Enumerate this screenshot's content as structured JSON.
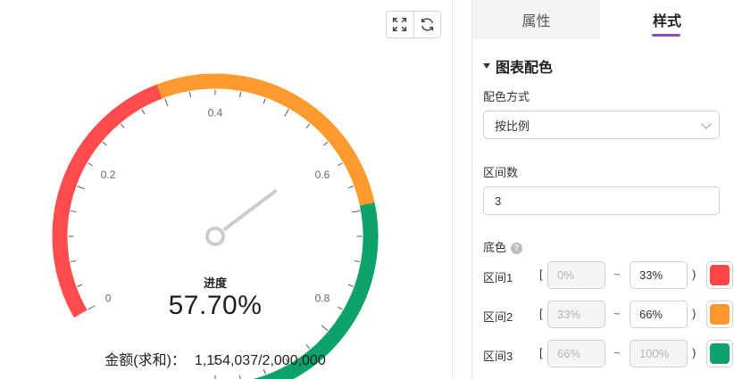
{
  "toolbar": {
    "fullscreen_icon": "fullscreen-icon",
    "refresh_icon": "refresh-icon"
  },
  "gauge": {
    "metric_name": "进度",
    "value_text": "57.70%",
    "value": 0.577,
    "min": 0,
    "max": 1,
    "ticks": [
      "0",
      "0.2",
      "0.4",
      "0.6",
      "0.8",
      "1"
    ],
    "bands": [
      {
        "from": 0,
        "to": 0.33,
        "color": "#ff4d4f"
      },
      {
        "from": 0.33,
        "to": 0.66,
        "color": "#ff9a2e"
      },
      {
        "from": 0.66,
        "to": 1,
        "color": "#0ea26b"
      }
    ],
    "pointer_color": "#cccccc",
    "amount_label": "金额(求和)：",
    "amount_value": "1,154,037/2,000,000"
  },
  "panel": {
    "tabs": [
      "属性",
      "样式"
    ],
    "active_tab": "样式",
    "section_title": "图表配色",
    "color_mode_label": "配色方式",
    "color_mode_value": "按比例",
    "interval_count_label": "区间数",
    "interval_count_value": "3",
    "base_color_label": "底色",
    "help_icon": "?",
    "ranges": [
      {
        "label": "区间1",
        "from": "0%",
        "to": "33%",
        "color": "#ff4545",
        "from_disabled": true,
        "to_disabled": false
      },
      {
        "label": "区间2",
        "from": "33%",
        "to": "66%",
        "color": "#ff962e",
        "from_disabled": true,
        "to_disabled": false
      },
      {
        "label": "区间3",
        "from": "66%",
        "to": "100%",
        "color": "#0ea26b",
        "from_disabled": true,
        "to_disabled": true
      }
    ]
  }
}
